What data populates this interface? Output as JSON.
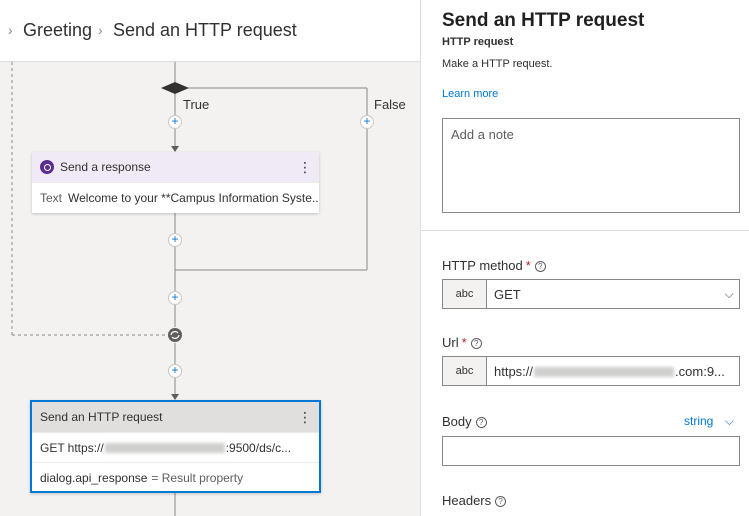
{
  "breadcrumb": {
    "items": [
      "Greeting",
      "Send an HTTP request"
    ]
  },
  "flow": {
    "branch_true": "True",
    "branch_false": "False",
    "send_response": {
      "title": "Send a response",
      "row_label": "Text",
      "row_value": "Welcome to your **Campus Information Syste..."
    },
    "http_request": {
      "title": "Send an HTTP request",
      "url_method": "GET",
      "url_prefix": "https://",
      "url_suffix": ":9500/ds/c...",
      "result_property": "dialog.api_response",
      "result_label": "= Result property"
    }
  },
  "panel": {
    "title": "Send an HTTP request",
    "subtitle": "HTTP request",
    "description": "Make a HTTP request.",
    "learn_more": "Learn more",
    "note_placeholder": "Add a note",
    "http_method": {
      "label": "HTTP method",
      "type": "abc",
      "value": "GET"
    },
    "url": {
      "label": "Url",
      "type": "abc",
      "prefix": "https://",
      "suffix": ".com:9..."
    },
    "body": {
      "label": "Body",
      "type_select": "string"
    },
    "headers": {
      "label": "Headers"
    }
  },
  "icons": {
    "breadcrumb_separator": "chevron-right-icon",
    "more": "more-vertical-icon",
    "add": "plus-icon",
    "loop": "loop-icon",
    "help": "help-circle-icon",
    "dropdown": "chevron-down-icon",
    "response": "chat-response-icon"
  },
  "colors": {
    "accent": "#0078d4",
    "response_icon": "#5c2d91",
    "selected_border": "#0078d4",
    "required": "#a4262c"
  }
}
